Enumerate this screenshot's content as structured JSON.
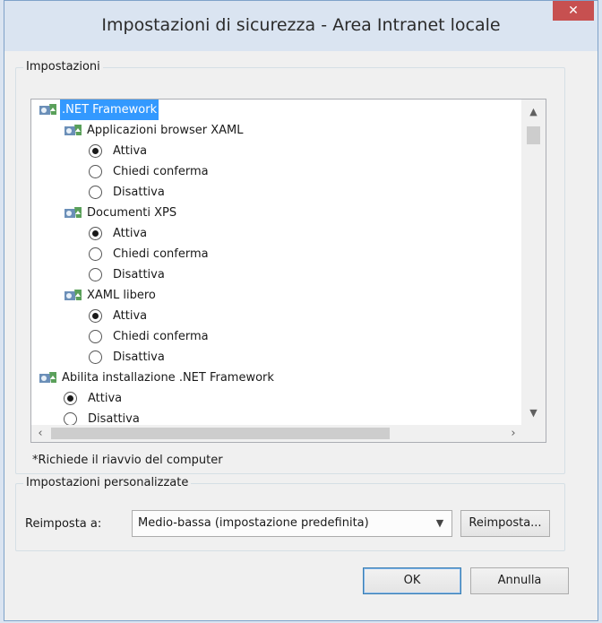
{
  "window": {
    "title": "Impostazioni di sicurezza - Area Intranet locale",
    "close_glyph": "✕"
  },
  "settings_group": {
    "legend": "Impostazioni",
    "tree": {
      "net_framework": ".NET Framework",
      "xaml_browser_apps": "Applicazioni browser XAML",
      "xps_documents": "Documenti XPS",
      "loose_xaml": "XAML libero",
      "enable_install": "Abilita installazione .NET Framework",
      "opt_active": "Attiva",
      "opt_prompt": "Chiedi conferma",
      "opt_disable": "Disattiva"
    },
    "note": "*Richiede il riavvio del computer"
  },
  "custom_group": {
    "legend": "Impostazioni personalizzate",
    "reset_label": "Reimposta a:",
    "reset_value": "Medio-bassa (impostazione predefinita)",
    "reset_button": "Reimposta..."
  },
  "buttons": {
    "ok": "OK",
    "cancel": "Annulla"
  },
  "colors": {
    "selection": "#3399ff",
    "titlebar": "#dae4f1",
    "close": "#c75050"
  }
}
